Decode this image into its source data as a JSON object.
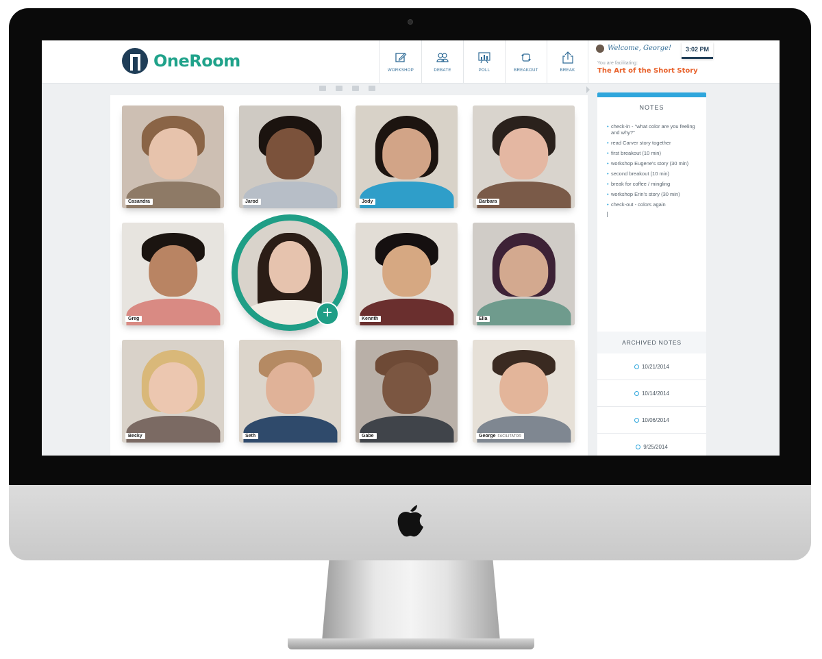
{
  "app": {
    "name": "OneRoom"
  },
  "toolbar": {
    "items": [
      {
        "label": "WORKSHOP",
        "icon": "pencil-icon"
      },
      {
        "label": "DEBATE",
        "icon": "people-icon"
      },
      {
        "label": "POLL",
        "icon": "chart-board-icon"
      },
      {
        "label": "BREAKOUT",
        "icon": "refresh-icon"
      },
      {
        "label": "BREAK",
        "icon": "share-icon"
      }
    ]
  },
  "header": {
    "welcome": "Welcome, George!",
    "clock": "3:02 PM",
    "facilitating_label": "You are facilitating:",
    "session_title": "The Art of the Short Story"
  },
  "media_controls": [
    "camera-icon",
    "mic-icon",
    "screen-icon",
    "signal-icon"
  ],
  "participants": [
    {
      "name": "Casandra",
      "role": ""
    },
    {
      "name": "Jarod",
      "role": ""
    },
    {
      "name": "Jody",
      "role": ""
    },
    {
      "name": "Barbara",
      "role": ""
    },
    {
      "name": "Greg",
      "role": ""
    },
    {
      "name": "",
      "role": ""
    },
    {
      "name": "Kennth",
      "role": ""
    },
    {
      "name": "Ella",
      "role": ""
    },
    {
      "name": "Becky",
      "role": ""
    },
    {
      "name": "Seth",
      "role": ""
    },
    {
      "name": "Gabe",
      "role": ""
    },
    {
      "name": "George",
      "role": "FACILITATOR"
    }
  ],
  "active_speaker": {
    "add_button": "+"
  },
  "notes": {
    "heading": "NOTES",
    "items": [
      "check-in - \"what color are you feeling and why?\"",
      "read Carver story together",
      "first breakout (10 min)",
      "workshop Eugene's story (30 min)",
      "second breakout (10 min)",
      "break for coffee / mingling",
      "workshop Erin's story (30 min)",
      "check-out - colors again"
    ],
    "archived_heading": "ARCHIVED NOTES",
    "archived": [
      "10/21/2014",
      "10/14/2014",
      "10/06/2014",
      "9/25/2014"
    ]
  },
  "colors": {
    "brand_teal": "#1fa28a",
    "brand_navy": "#1f3d57",
    "accent_orange": "#e8622c",
    "accent_blue": "#2fa6dc"
  }
}
